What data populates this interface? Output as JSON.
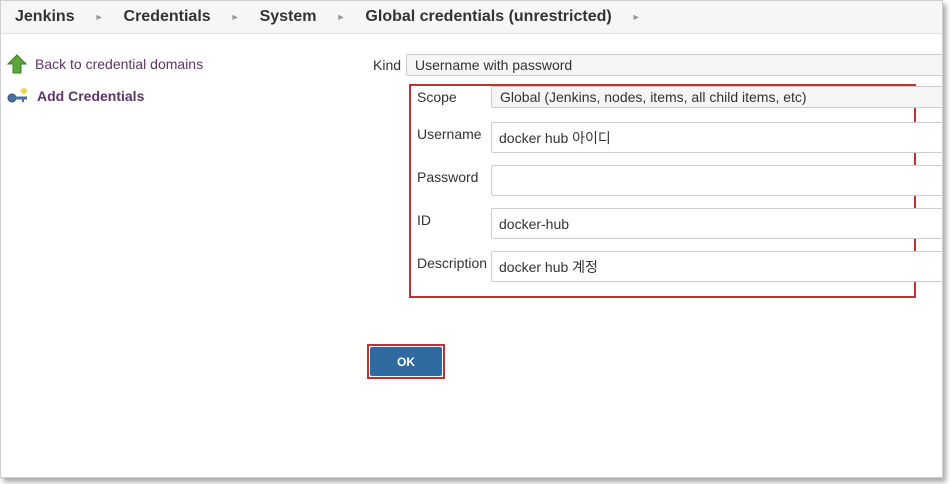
{
  "breadcrumb": {
    "items": [
      "Jenkins",
      "Credentials",
      "System",
      "Global credentials (unrestricted)"
    ]
  },
  "sidebar": {
    "back_label": "Back to credential domains",
    "add_label": "Add Credentials"
  },
  "form": {
    "kind_label": "Kind",
    "kind_value": "Username with password",
    "scope_label": "Scope",
    "scope_value": "Global (Jenkins, nodes, items, all child items, etc)",
    "username_label": "Username",
    "username_value": "docker hub 아이디",
    "password_label": "Password",
    "password_value": "",
    "id_label": "ID",
    "id_value": "docker-hub",
    "description_label": "Description",
    "description_value": "docker hub 계정"
  },
  "actions": {
    "ok_label": "OK"
  },
  "colors": {
    "highlight": "#b73535",
    "button": "#2f6aa1",
    "link": "#5c3566"
  }
}
